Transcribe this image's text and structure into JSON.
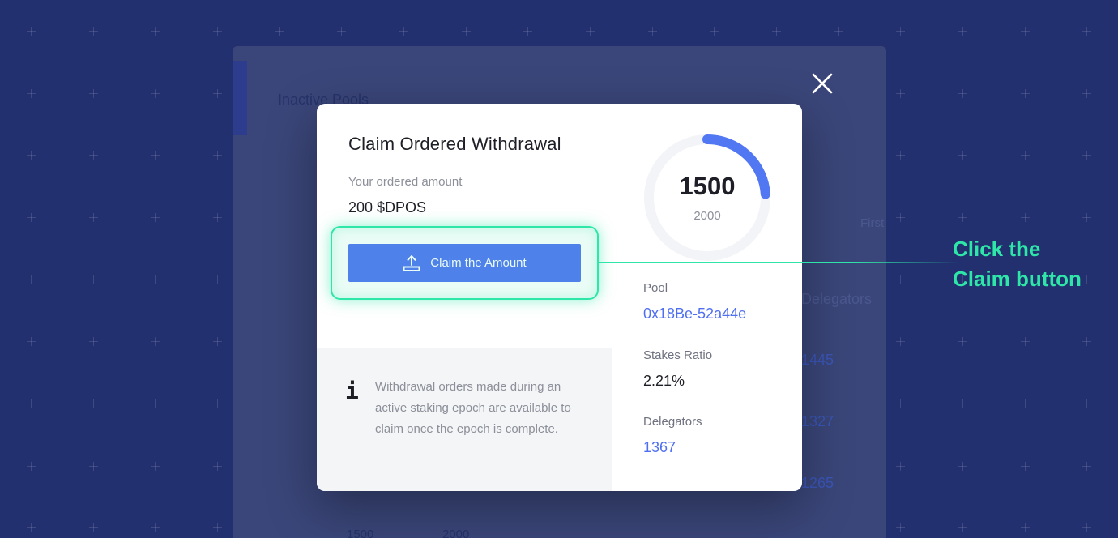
{
  "background": {
    "tab_label": "Inactive Pools",
    "first_label": "First",
    "column_header": "Delegators",
    "column_values": [
      "1445",
      "1327",
      "1265"
    ],
    "footer_values": [
      "1500",
      "2000"
    ]
  },
  "modal": {
    "title": "Claim Ordered Withdrawal",
    "ordered_label": "Your ordered amount",
    "ordered_value": "200 $DPOS",
    "claim_button_label": "Claim the Amount",
    "info_icon": "i",
    "info_text": "Withdrawal orders made during an active staking epoch are available to claim once the epoch is complete.",
    "gauge": {
      "value": "1500",
      "total": "2000",
      "progress_fraction": 0.24
    },
    "stats": {
      "pool_label": "Pool",
      "pool_value": "0x18Be-52a44e",
      "stakes_ratio_label": "Stakes Ratio",
      "stakes_ratio_value": "2.21%",
      "delegators_label": "Delegators",
      "delegators_value": "1367"
    }
  },
  "annotation": {
    "line1": "Click the",
    "line2": "Claim button"
  },
  "colors": {
    "background": "#22306f",
    "accent": "#5277f2",
    "highlight": "#2ee6a7",
    "link": "#4f6ff0"
  },
  "icons": [
    "upload-icon",
    "info-icon",
    "close-icon"
  ]
}
